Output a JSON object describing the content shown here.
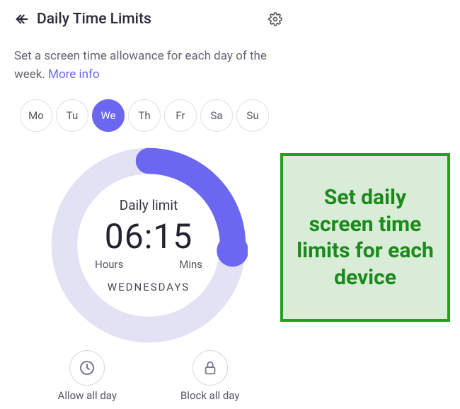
{
  "header": {
    "title": "Daily Time Limits"
  },
  "description": {
    "text": "Set a screen time allowance for each day of the week.",
    "more_info": "More info"
  },
  "days": [
    {
      "label": "Mo",
      "selected": false
    },
    {
      "label": "Tu",
      "selected": false
    },
    {
      "label": "We",
      "selected": true
    },
    {
      "label": "Th",
      "selected": false
    },
    {
      "label": "Fr",
      "selected": false
    },
    {
      "label": "Sa",
      "selected": false
    },
    {
      "label": "Su",
      "selected": false
    }
  ],
  "dial": {
    "label": "Daily limit",
    "time": "06:15",
    "hours_label": "Hours",
    "mins_label": "Mins",
    "day_name": "WEDNESDAYS",
    "colors": {
      "track": "#e2e2f4",
      "fill": "#6b67f0"
    }
  },
  "actions": {
    "allow": "Allow all day",
    "block": "Block all day"
  },
  "callout": {
    "text": "Set daily screen time limits for each device"
  }
}
